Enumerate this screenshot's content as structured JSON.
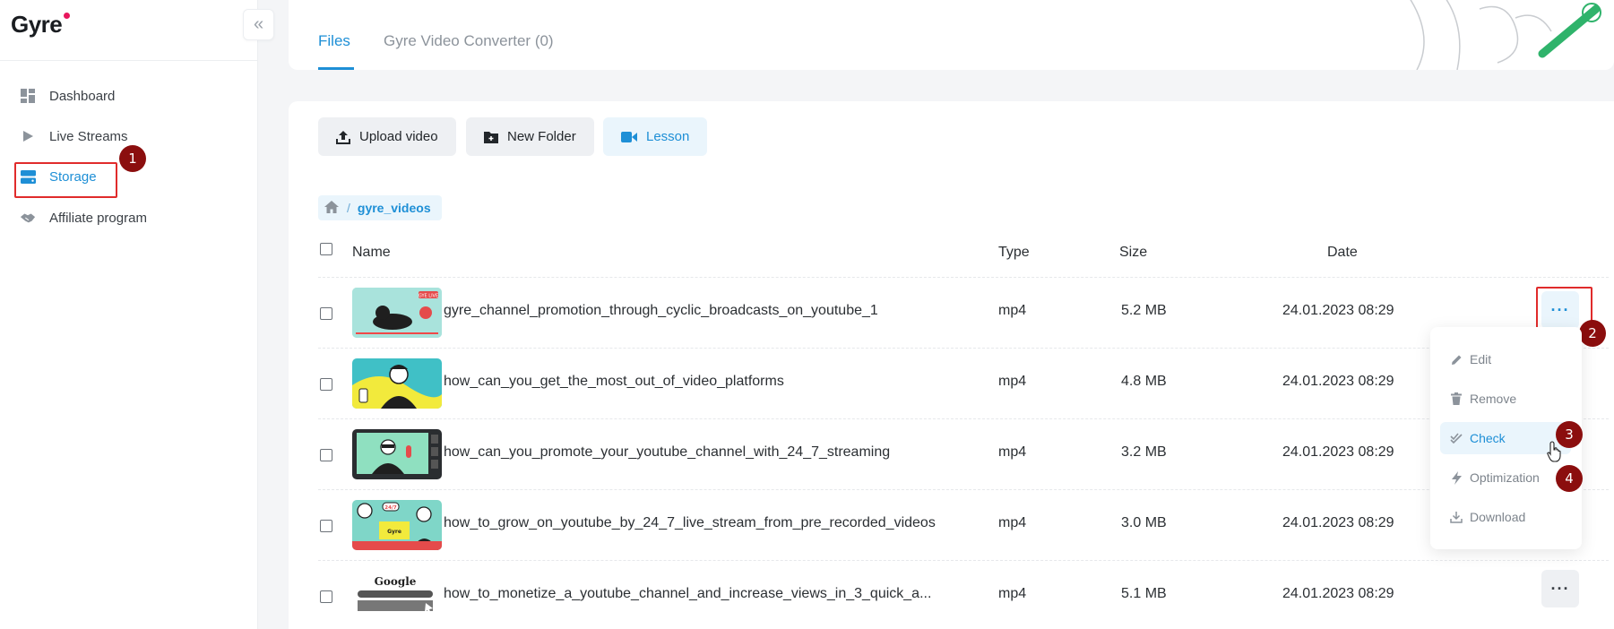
{
  "app": {
    "logo": "Gyre"
  },
  "sidebar": {
    "items": [
      {
        "label": "Dashboard",
        "icon": "dashboard-icon"
      },
      {
        "label": "Live Streams",
        "icon": "play-icon"
      },
      {
        "label": "Storage",
        "icon": "storage-icon",
        "active": true
      },
      {
        "label": "Affiliate program",
        "icon": "handshake-icon"
      }
    ]
  },
  "tabs": [
    {
      "label": "Files",
      "active": true
    },
    {
      "label": "Gyre Video Converter (0)",
      "active": false
    }
  ],
  "toolbar": {
    "upload_label": "Upload video",
    "new_folder_label": "New Folder",
    "lesson_label": "Lesson"
  },
  "breadcrumb": {
    "folder": "gyre_videos"
  },
  "table": {
    "headers": {
      "name": "Name",
      "type": "Type",
      "size": "Size",
      "date": "Date"
    },
    "rows": [
      {
        "name": "gyre_channel_promotion_through_cyclic_broadcasts_on_youtube_1",
        "type": "mp4",
        "size": "5.2 MB",
        "date": "24.01.2023 08:29"
      },
      {
        "name": "how_can_you_get_the_most_out_of_video_platforms",
        "type": "mp4",
        "size": "4.8 MB",
        "date": "24.01.2023 08:29"
      },
      {
        "name": "how_can_you_promote_your_youtube_channel_with_24_7_streaming",
        "type": "mp4",
        "size": "3.2 MB",
        "date": "24.01.2023 08:29"
      },
      {
        "name": "how_to_grow_on_youtube_by_24_7_live_stream_from_pre_recorded_videos",
        "type": "mp4",
        "size": "3.0 MB",
        "date": "24.01.2023 08:29"
      },
      {
        "name": "how_to_monetize_a_youtube_channel_and_increase_views_in_3_quick_a...",
        "type": "mp4",
        "size": "5.1 MB",
        "date": "24.01.2023 08:29"
      }
    ],
    "more_label": "···"
  },
  "context_menu": {
    "items": [
      {
        "label": "Edit",
        "icon": "pencil-icon"
      },
      {
        "label": "Remove",
        "icon": "trash-icon"
      },
      {
        "label": "Check",
        "icon": "double-check-icon",
        "active": true
      },
      {
        "label": "Optimization",
        "icon": "lightning-icon"
      },
      {
        "label": "Download",
        "icon": "download-icon"
      }
    ]
  },
  "annotations": {
    "step1": "1",
    "step2": "2",
    "step3": "3",
    "step4": "4"
  },
  "thumbnails": {
    "row1_label": "GYE LIVE",
    "row4_label": "Gyre",
    "row4_badge": "24/7",
    "row5_label": "Google"
  },
  "colors": {
    "accent": "#1e8fd6",
    "highlight": "#e02b2b",
    "badge": "#8b0e0e"
  }
}
